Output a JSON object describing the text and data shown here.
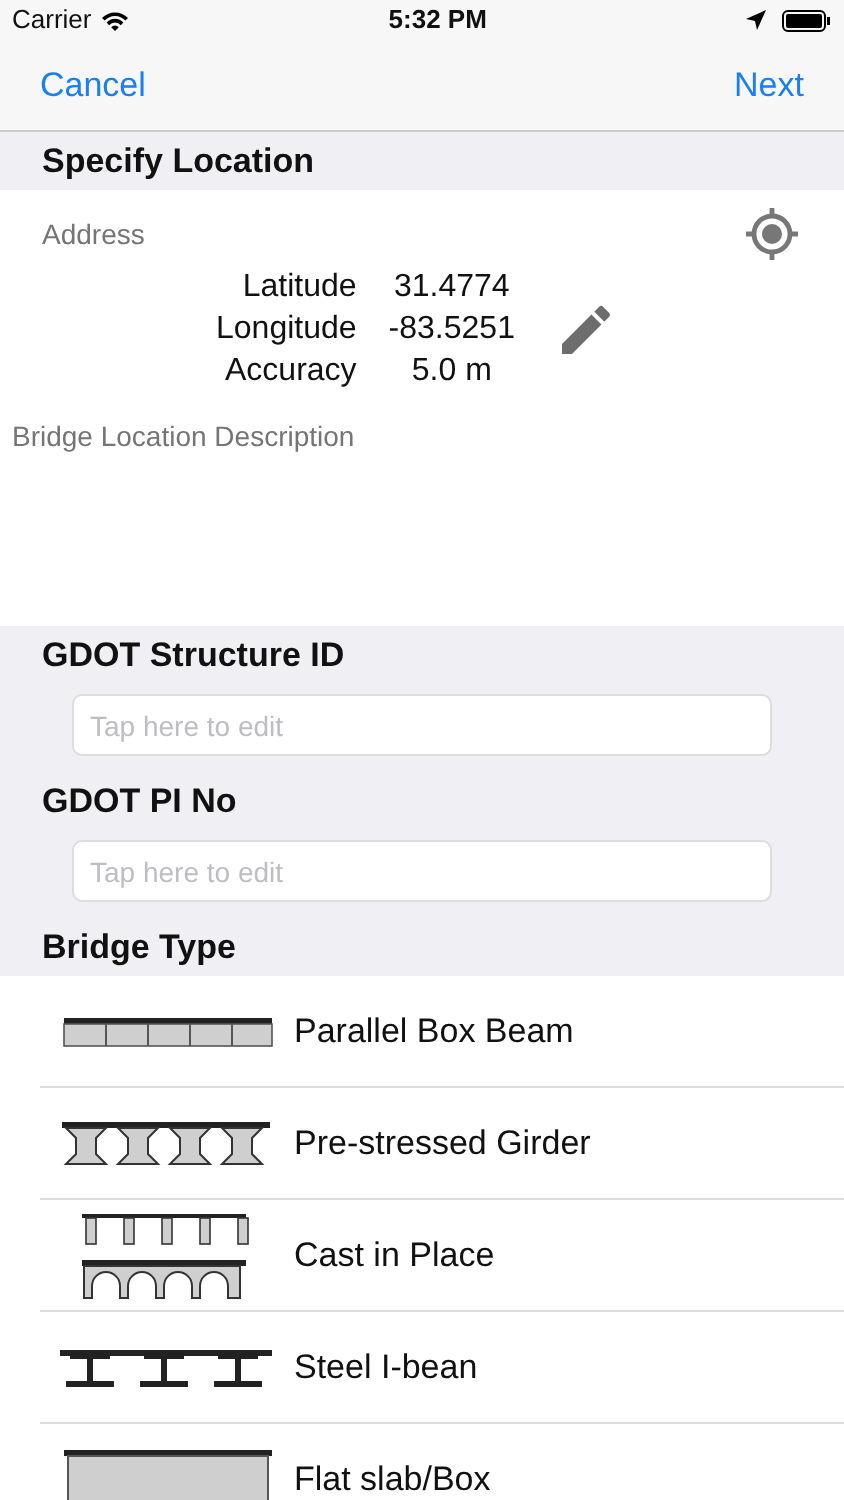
{
  "status_bar": {
    "carrier": "Carrier",
    "time": "5:32 PM"
  },
  "nav": {
    "left": "Cancel",
    "right": "Next"
  },
  "location": {
    "header": "Specify Location",
    "address_placeholder": "Address",
    "readings": [
      {
        "label": "Latitude",
        "value": "31.4774"
      },
      {
        "label": "Longitude",
        "value": "-83.5251"
      },
      {
        "label": "Accuracy",
        "value": "5.0 m"
      }
    ],
    "description_placeholder": "Bridge Location Description"
  },
  "fields": [
    {
      "header": "GDOT Structure ID",
      "placeholder": "Tap here to edit"
    },
    {
      "header": "GDOT PI No",
      "placeholder": "Tap here to edit"
    }
  ],
  "bridge_type": {
    "header": "Bridge Type",
    "items": [
      {
        "kind": "box",
        "label": "Parallel Box Beam"
      },
      {
        "kind": "girder",
        "label": "Pre-stressed Girder"
      },
      {
        "kind": "cast",
        "label": "Cast in Place"
      },
      {
        "kind": "ibeam",
        "label": "Steel I-bean"
      },
      {
        "kind": "slab",
        "label": "Flat slab/Box"
      }
    ]
  }
}
